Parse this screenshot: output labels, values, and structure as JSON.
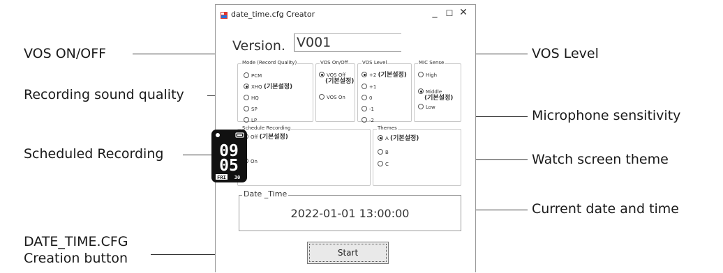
{
  "window": {
    "title": "date_time.cfg Creator",
    "minimize": "_",
    "maximize": "☐",
    "close": "✕"
  },
  "version": {
    "label": "Version.",
    "value": "V001"
  },
  "mode_group": {
    "legend": "Mode (Record Quality)",
    "options": [
      {
        "label": "PCM",
        "selected": false,
        "note": ""
      },
      {
        "label": "XHQ",
        "selected": true,
        "note": "(기본설정)"
      },
      {
        "label": "HQ",
        "selected": false,
        "note": ""
      },
      {
        "label": "SP",
        "selected": false,
        "note": ""
      },
      {
        "label": "LP",
        "selected": false,
        "note": ""
      }
    ]
  },
  "vos_group": {
    "legend": "VOS On/Off",
    "off_label": "VOS Off",
    "off_note": "(기본설정)",
    "on_label": "VOS On"
  },
  "vos_level_group": {
    "legend": "VOS Level",
    "options": [
      {
        "label": "+2",
        "note": "(기본설정)"
      },
      {
        "label": "+1",
        "note": ""
      },
      {
        "label": "0",
        "note": ""
      },
      {
        "label": "-1",
        "note": ""
      },
      {
        "label": "-2",
        "note": ""
      }
    ]
  },
  "mic_group": {
    "legend": "MIC Sense",
    "high": "High",
    "middle": "Middle",
    "middle_note": "(기본설정)",
    "low": "Low"
  },
  "schedule_group": {
    "legend": "Schedule Recording",
    "off_label": "Off",
    "off_note": "(기본설정)",
    "on_label": "On"
  },
  "themes_group": {
    "legend": "Themes",
    "a_label": "A",
    "a_note": "(기본설정)",
    "b_label": "B",
    "c_label": "C"
  },
  "watch": {
    "hour": "09",
    "minute": "05",
    "day": "FRI",
    "date": "30"
  },
  "datetime_group": {
    "legend": "Date _Time",
    "value": "2022-01-01 13:00:00"
  },
  "start_button": {
    "label": "Start"
  },
  "callouts": {
    "vos_onoff": "VOS ON/OFF",
    "recording_quality": "Recording sound quality",
    "scheduled": "Scheduled Recording",
    "creation_line1": "DATE_TIME.CFG",
    "creation_line2": "Creation button",
    "vos_level": "VOS Level",
    "mic": "Microphone sensitivity",
    "theme": "Watch screen theme",
    "datetime": "Current date and time"
  },
  "colors": {
    "icon_red": "#e0362c",
    "icon_blue": "#2a6fd6",
    "watch_bg": "#111111"
  }
}
